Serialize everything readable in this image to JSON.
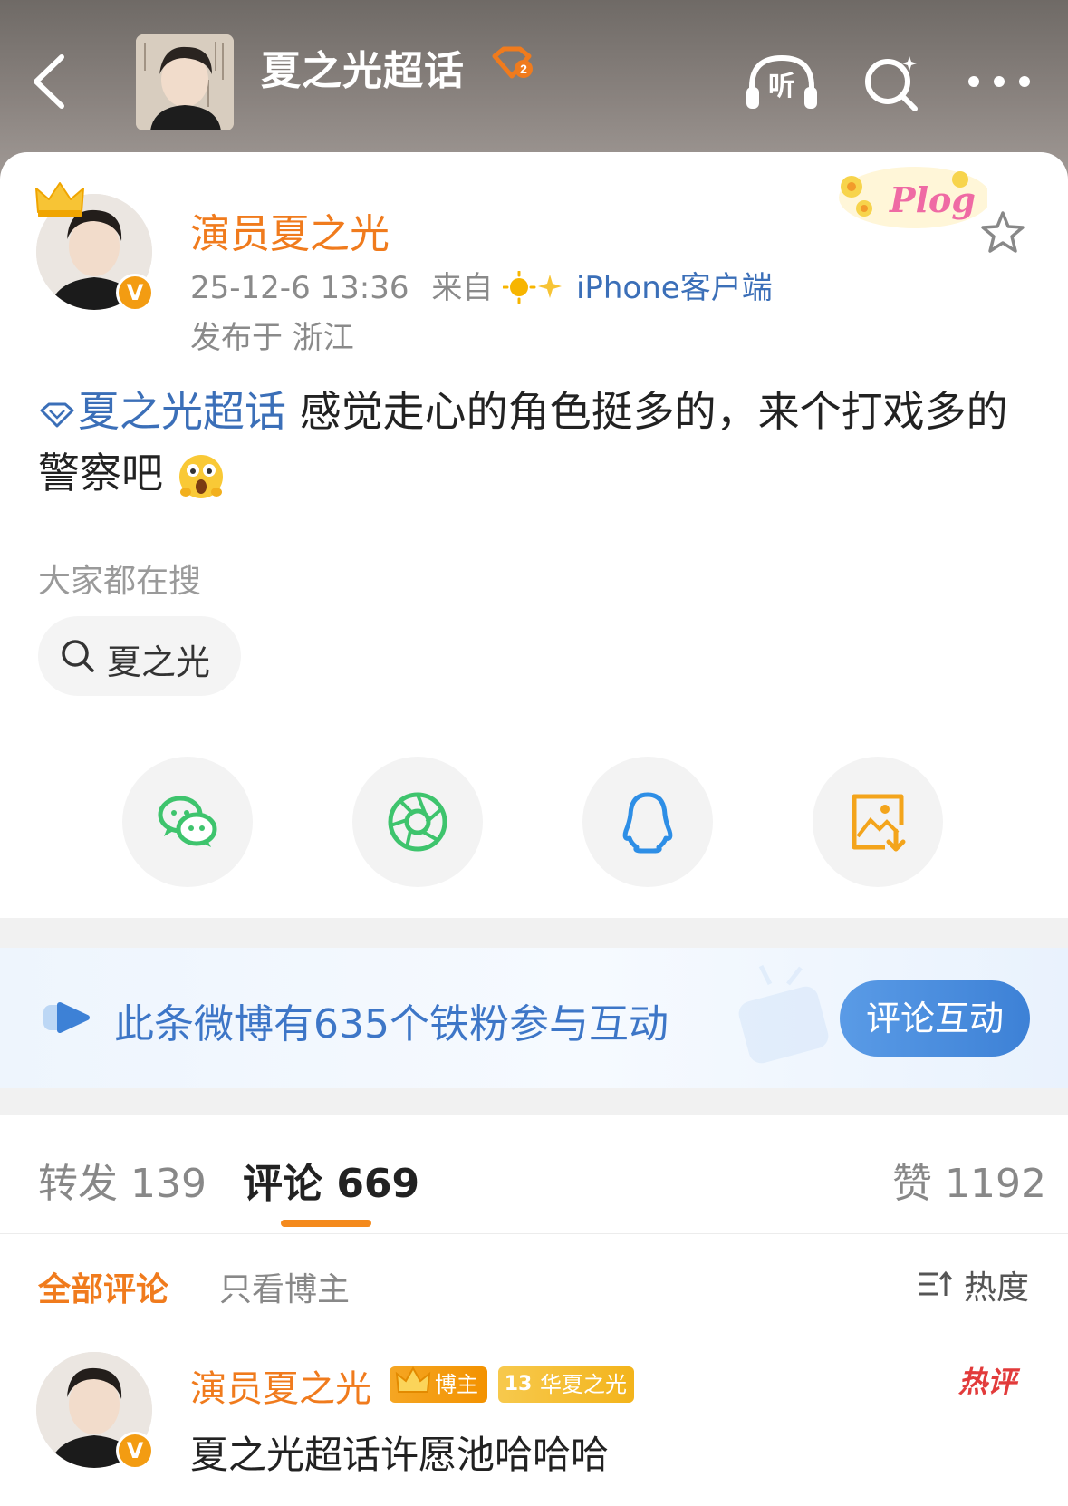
{
  "header": {
    "topic_title": "夏之光超话",
    "listen_label": "听"
  },
  "post": {
    "author": "演员夏之光",
    "timestamp": "25-12-6 13:36",
    "source_prefix": "来自",
    "source": "iPhone客户端",
    "location": "发布于 浙江",
    "topic_link": "夏之光超话",
    "text_body": " 感觉走心的角色挺多的，来个打戏多的警察吧",
    "sticker_label": "Plog",
    "verified_mark": "V"
  },
  "search_hint": {
    "label": "大家都在搜",
    "chip": "夏之光"
  },
  "share": {
    "icons": [
      "wechat-icon",
      "moments-icon",
      "qq-icon",
      "save-image-icon"
    ],
    "colors": {
      "wechat": "#3ec46d",
      "moments": "#3ec46d",
      "qq": "#2d8ee6",
      "save": "#f3a41b"
    }
  },
  "fan_banner": {
    "text": "此条微博有635个铁粉参与互动",
    "button": "评论互动"
  },
  "stats": {
    "repost": "转发 139",
    "comment": "评论 669",
    "like": "赞 1192"
  },
  "comments": {
    "filter_all": "全部评论",
    "filter_author": "只看博主",
    "sort": "热度",
    "items": [
      {
        "author": "演员夏之光",
        "badge_author": "博主",
        "badge_fan_level": "13",
        "badge_fan": "华夏之光",
        "hot_tag": "热评",
        "text": "夏之光超话许愿池哈哈哈",
        "verified_mark": "V"
      }
    ]
  },
  "colors": {
    "accent_orange": "#f07b1d",
    "link_blue": "#3b6fb8",
    "hot_red": "#e23b3b"
  }
}
